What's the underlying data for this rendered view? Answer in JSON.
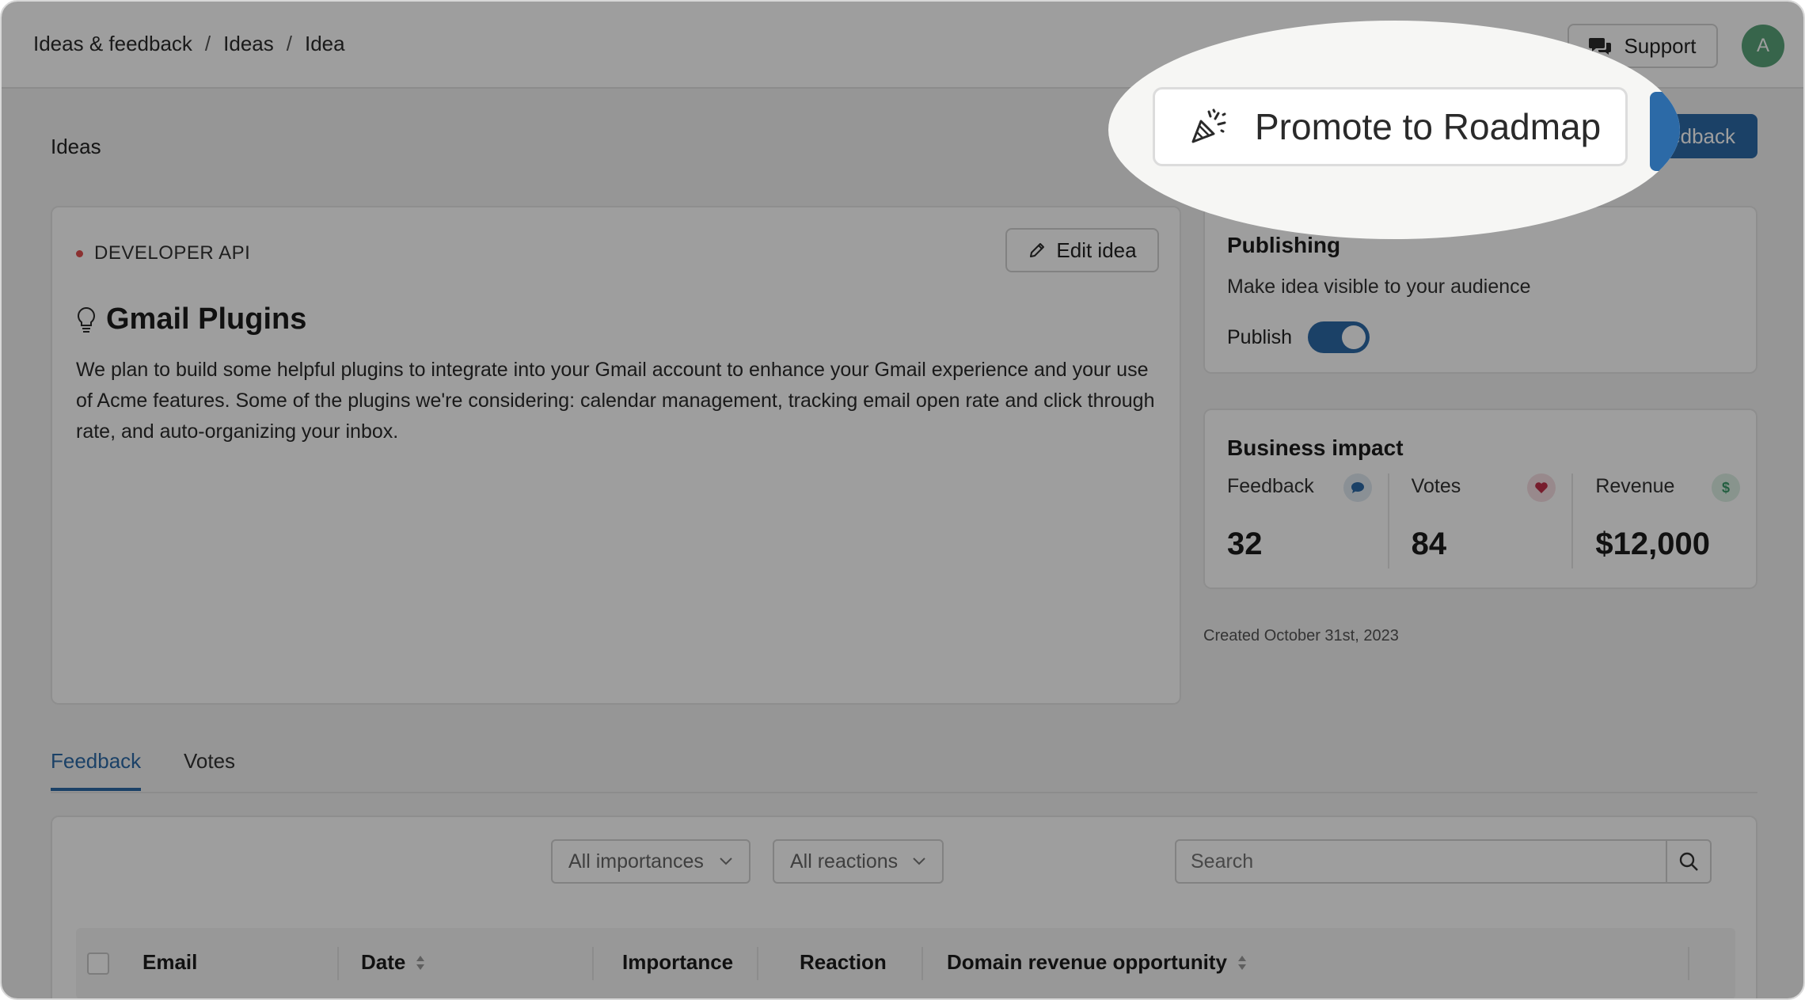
{
  "breadcrumb": {
    "item1": "Ideas & feedback",
    "item2": "Ideas",
    "item3": "Idea",
    "separator": "/"
  },
  "header": {
    "support_label": "Support",
    "avatar_initial": "A"
  },
  "page": {
    "title": "Ideas",
    "new_feedback_label": "edback"
  },
  "idea": {
    "tag": "DEVELOPER API",
    "edit_label": "Edit idea",
    "title": "Gmail Plugins",
    "description": "We plan to build some helpful plugins to integrate into your Gmail account to enhance your Gmail experience and your use of Acme features. Some of the plugins we're considering: calendar management, tracking email open rate and click through rate, and auto-organizing your inbox."
  },
  "publishing": {
    "title": "Publishing",
    "subtitle": "Make idea visible to your audience",
    "publish_label": "Publish",
    "published": true
  },
  "impact": {
    "title": "Business impact",
    "feedback_label": "Feedback",
    "feedback_value": "32",
    "votes_label": "Votes",
    "votes_value": "84",
    "revenue_label": "Revenue",
    "revenue_value": "$12,000",
    "revenue_icon_glyph": "$"
  },
  "created": "Created October 31st, 2023",
  "tabs": {
    "feedback": "Feedback",
    "votes": "Votes",
    "active": "Feedback"
  },
  "filters": {
    "importance": "All importances",
    "reactions": "All reactions",
    "search_placeholder": "Search"
  },
  "table": {
    "col_email": "Email",
    "col_date": "Date",
    "col_importance": "Importance",
    "col_reaction": "Reaction",
    "col_revenue": "Domain revenue opportunity"
  },
  "spotlight": {
    "promote_label": "Promote to Roadmap"
  },
  "colors": {
    "accent": "#2c6aa7",
    "tag_dot": "#e05050",
    "avatar": "#5aa37a",
    "feedback_icon": "#2c6aa7",
    "votes_icon": "#c0304a",
    "revenue_icon": "#3a9a6a"
  },
  "icons": {
    "support": "chat-bubbles-icon",
    "edit": "pencil-icon",
    "idea": "lightbulb-icon",
    "search": "search-icon",
    "promote": "party-popper-icon"
  }
}
